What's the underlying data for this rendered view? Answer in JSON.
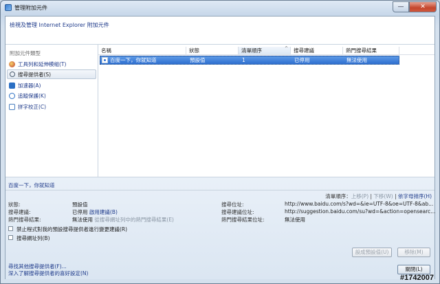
{
  "window": {
    "title": "管理附加元件",
    "close_label": "✕",
    "min_label": "—"
  },
  "header": {
    "text": "檢視及管理 Internet Explorer 附加元件"
  },
  "sidebar": {
    "title": "附加元件類型",
    "items": [
      {
        "label": "工具列和延伸模組(T)",
        "icon": "toolbar-icon",
        "selected": false
      },
      {
        "label": "搜尋提供者(S)",
        "icon": "search-icon",
        "selected": true
      },
      {
        "label": "加速器(A)",
        "icon": "accelerator-icon",
        "selected": false
      },
      {
        "label": "追蹤保護(K)",
        "icon": "tracking-icon",
        "selected": false
      },
      {
        "label": "拼字校正(C)",
        "icon": "spelling-icon",
        "selected": false
      }
    ]
  },
  "table": {
    "columns": [
      "名稱",
      "狀態",
      "清單順序",
      "搜尋建議",
      "熱門搜尋結果"
    ],
    "rows": [
      {
        "name": "百度一下，你就知道",
        "status": "預設值",
        "order": "1",
        "suggest": "已停用",
        "top": "無法使用"
      }
    ]
  },
  "details": {
    "title": "百度一下，你就知道",
    "order_label": "清單順序：",
    "move_up": "上移(P)",
    "sep1": " | ",
    "move_down": "下移(W)",
    "sep2": " | ",
    "sort_alpha": "依字母排序(H)",
    "status_label": "狀態:",
    "status_value": "預設值",
    "suggest_label": "搜尋建議:",
    "suggest_value": "已停用",
    "suggest_link": "啟用建議(B)",
    "top_label": "熱門搜尋結果:",
    "top_value": "無法使用",
    "top_note": "從搜尋網址列中的熱門搜尋結果(E)",
    "addr_label": "搜尋位址:",
    "addr_value": "http://www.baidu.com/s?wd=&ie=UTF-8&oe=UTF-8&ab...",
    "sugaddr_label": "搜尋建議位址:",
    "sugaddr_value": "http://suggestion.baidu.com/su?wd=&action=opensearc...",
    "topaddr_label": "熱門搜尋結果位址:",
    "topaddr_value": "無法使用",
    "chk1": "禁止程式對我的預設搜尋提供者進行變更建議(R)",
    "chk2": "搜尋網址列(B)",
    "set_default": "設成預設值(U)",
    "remove": "移除(M)"
  },
  "footer": {
    "find_more": "尋找其他搜尋提供者(F)...",
    "learn_more": "深入了解搜尋提供者的喜好設定(N)",
    "close_button": "關閉(L)",
    "stamp": "#1742007"
  }
}
